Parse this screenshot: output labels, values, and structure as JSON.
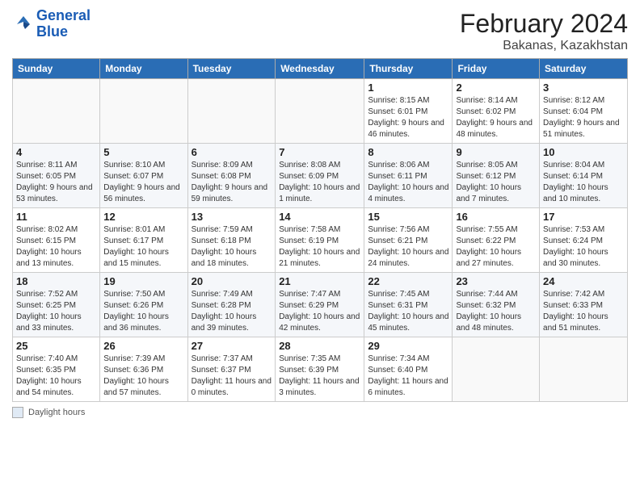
{
  "header": {
    "logo_line1": "General",
    "logo_line2": "Blue",
    "title": "February 2024",
    "subtitle": "Bakanas, Kazakhstan"
  },
  "days_of_week": [
    "Sunday",
    "Monday",
    "Tuesday",
    "Wednesday",
    "Thursday",
    "Friday",
    "Saturday"
  ],
  "weeks": [
    [
      {
        "day": "",
        "info": ""
      },
      {
        "day": "",
        "info": ""
      },
      {
        "day": "",
        "info": ""
      },
      {
        "day": "",
        "info": ""
      },
      {
        "day": "1",
        "info": "Sunrise: 8:15 AM\nSunset: 6:01 PM\nDaylight: 9 hours and 46 minutes."
      },
      {
        "day": "2",
        "info": "Sunrise: 8:14 AM\nSunset: 6:02 PM\nDaylight: 9 hours and 48 minutes."
      },
      {
        "day": "3",
        "info": "Sunrise: 8:12 AM\nSunset: 6:04 PM\nDaylight: 9 hours and 51 minutes."
      }
    ],
    [
      {
        "day": "4",
        "info": "Sunrise: 8:11 AM\nSunset: 6:05 PM\nDaylight: 9 hours and 53 minutes."
      },
      {
        "day": "5",
        "info": "Sunrise: 8:10 AM\nSunset: 6:07 PM\nDaylight: 9 hours and 56 minutes."
      },
      {
        "day": "6",
        "info": "Sunrise: 8:09 AM\nSunset: 6:08 PM\nDaylight: 9 hours and 59 minutes."
      },
      {
        "day": "7",
        "info": "Sunrise: 8:08 AM\nSunset: 6:09 PM\nDaylight: 10 hours and 1 minute."
      },
      {
        "day": "8",
        "info": "Sunrise: 8:06 AM\nSunset: 6:11 PM\nDaylight: 10 hours and 4 minutes."
      },
      {
        "day": "9",
        "info": "Sunrise: 8:05 AM\nSunset: 6:12 PM\nDaylight: 10 hours and 7 minutes."
      },
      {
        "day": "10",
        "info": "Sunrise: 8:04 AM\nSunset: 6:14 PM\nDaylight: 10 hours and 10 minutes."
      }
    ],
    [
      {
        "day": "11",
        "info": "Sunrise: 8:02 AM\nSunset: 6:15 PM\nDaylight: 10 hours and 13 minutes."
      },
      {
        "day": "12",
        "info": "Sunrise: 8:01 AM\nSunset: 6:17 PM\nDaylight: 10 hours and 15 minutes."
      },
      {
        "day": "13",
        "info": "Sunrise: 7:59 AM\nSunset: 6:18 PM\nDaylight: 10 hours and 18 minutes."
      },
      {
        "day": "14",
        "info": "Sunrise: 7:58 AM\nSunset: 6:19 PM\nDaylight: 10 hours and 21 minutes."
      },
      {
        "day": "15",
        "info": "Sunrise: 7:56 AM\nSunset: 6:21 PM\nDaylight: 10 hours and 24 minutes."
      },
      {
        "day": "16",
        "info": "Sunrise: 7:55 AM\nSunset: 6:22 PM\nDaylight: 10 hours and 27 minutes."
      },
      {
        "day": "17",
        "info": "Sunrise: 7:53 AM\nSunset: 6:24 PM\nDaylight: 10 hours and 30 minutes."
      }
    ],
    [
      {
        "day": "18",
        "info": "Sunrise: 7:52 AM\nSunset: 6:25 PM\nDaylight: 10 hours and 33 minutes."
      },
      {
        "day": "19",
        "info": "Sunrise: 7:50 AM\nSunset: 6:26 PM\nDaylight: 10 hours and 36 minutes."
      },
      {
        "day": "20",
        "info": "Sunrise: 7:49 AM\nSunset: 6:28 PM\nDaylight: 10 hours and 39 minutes."
      },
      {
        "day": "21",
        "info": "Sunrise: 7:47 AM\nSunset: 6:29 PM\nDaylight: 10 hours and 42 minutes."
      },
      {
        "day": "22",
        "info": "Sunrise: 7:45 AM\nSunset: 6:31 PM\nDaylight: 10 hours and 45 minutes."
      },
      {
        "day": "23",
        "info": "Sunrise: 7:44 AM\nSunset: 6:32 PM\nDaylight: 10 hours and 48 minutes."
      },
      {
        "day": "24",
        "info": "Sunrise: 7:42 AM\nSunset: 6:33 PM\nDaylight: 10 hours and 51 minutes."
      }
    ],
    [
      {
        "day": "25",
        "info": "Sunrise: 7:40 AM\nSunset: 6:35 PM\nDaylight: 10 hours and 54 minutes."
      },
      {
        "day": "26",
        "info": "Sunrise: 7:39 AM\nSunset: 6:36 PM\nDaylight: 10 hours and 57 minutes."
      },
      {
        "day": "27",
        "info": "Sunrise: 7:37 AM\nSunset: 6:37 PM\nDaylight: 11 hours and 0 minutes."
      },
      {
        "day": "28",
        "info": "Sunrise: 7:35 AM\nSunset: 6:39 PM\nDaylight: 11 hours and 3 minutes."
      },
      {
        "day": "29",
        "info": "Sunrise: 7:34 AM\nSunset: 6:40 PM\nDaylight: 11 hours and 6 minutes."
      },
      {
        "day": "",
        "info": ""
      },
      {
        "day": "",
        "info": ""
      }
    ]
  ],
  "footer": {
    "label": "Daylight hours"
  }
}
